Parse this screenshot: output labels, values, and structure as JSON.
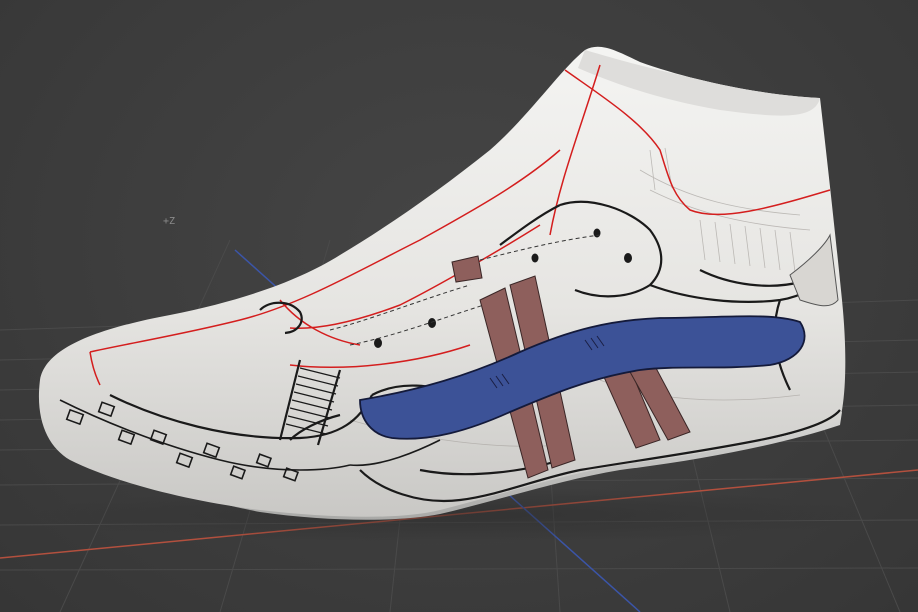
{
  "viewport": {
    "axis_label_z": "+Z",
    "colors": {
      "background": "#3d3d3d",
      "grid_line": "#4a4a4a",
      "x_axis": "#b3503e",
      "y_axis": "#3b55a8",
      "shoe_base": "#ecebe8",
      "outline_red": "#d41e1e",
      "sketch_black": "#1a1a1a",
      "stripe_blue": "#3c5297",
      "stripe_brown": "#8e5f5c"
    }
  },
  "model": {
    "object_type": "shoe-last",
    "texture": "sketch-texture"
  }
}
